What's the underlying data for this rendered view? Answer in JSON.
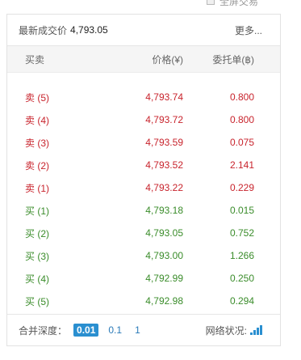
{
  "topbar": {
    "label": "全屏交易"
  },
  "header": {
    "latest_label": "最新成交价",
    "latest_value": "4,793.05",
    "more": "更多..."
  },
  "columns": {
    "side": "买卖",
    "price": "价格(¥)",
    "amount": "委托单(฿)"
  },
  "asks": [
    {
      "label": "卖 (5)",
      "price": "4,793.74",
      "amount": "0.800"
    },
    {
      "label": "卖 (4)",
      "price": "4,793.72",
      "amount": "0.800"
    },
    {
      "label": "卖 (3)",
      "price": "4,793.59",
      "amount": "0.075"
    },
    {
      "label": "卖 (2)",
      "price": "4,793.52",
      "amount": "2.141"
    },
    {
      "label": "卖 (1)",
      "price": "4,793.22",
      "amount": "0.229"
    }
  ],
  "bids": [
    {
      "label": "买 (1)",
      "price": "4,793.18",
      "amount": "0.015"
    },
    {
      "label": "买 (2)",
      "price": "4,793.05",
      "amount": "0.752"
    },
    {
      "label": "买 (3)",
      "price": "4,793.00",
      "amount": "1.266"
    },
    {
      "label": "买 (4)",
      "price": "4,792.99",
      "amount": "0.250"
    },
    {
      "label": "买 (5)",
      "price": "4,792.98",
      "amount": "0.294"
    }
  ],
  "footer": {
    "depth_label": "合并深度：",
    "depth_options": [
      "0.01",
      "0.1",
      "1"
    ],
    "network_label": "网络状况:"
  },
  "colors": {
    "ask": "#c8232c",
    "bid": "#3a8c2a",
    "accent": "#2a8fd0"
  },
  "icons": {
    "network": "signal-bars-icon",
    "fullscreen": "fullscreen-icon"
  }
}
